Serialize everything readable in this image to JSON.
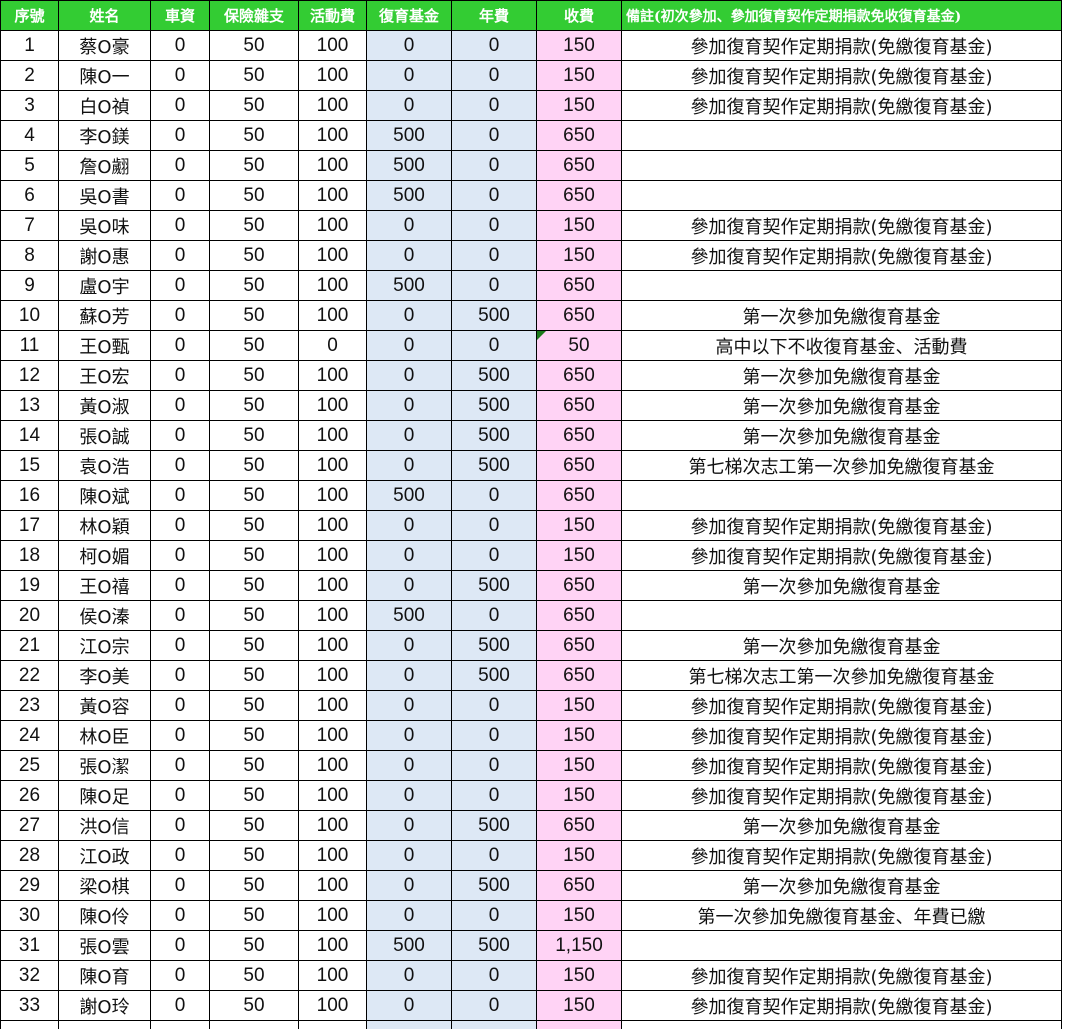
{
  "headers": [
    "序號",
    "姓名",
    "車資",
    "保險雜支",
    "活動費",
    "復育基金",
    "年費",
    "收費",
    "備註(初次參加、參加復育契作定期捐款免收復育基金)"
  ],
  "rows": [
    {
      "no": "1",
      "name": "蔡O豪",
      "fare": "0",
      "insurance": "50",
      "activity": "100",
      "fund": "0",
      "annual": "0",
      "total": "150",
      "note": "參加復育契作定期捐款(免繳復育基金)"
    },
    {
      "no": "2",
      "name": "陳O一",
      "fare": "0",
      "insurance": "50",
      "activity": "100",
      "fund": "0",
      "annual": "0",
      "total": "150",
      "note": "參加復育契作定期捐款(免繳復育基金)"
    },
    {
      "no": "3",
      "name": "白O禎",
      "fare": "0",
      "insurance": "50",
      "activity": "100",
      "fund": "0",
      "annual": "0",
      "total": "150",
      "note": "參加復育契作定期捐款(免繳復育基金)"
    },
    {
      "no": "4",
      "name": "李O鎂",
      "fare": "0",
      "insurance": "50",
      "activity": "100",
      "fund": "500",
      "annual": "0",
      "total": "650",
      "note": ""
    },
    {
      "no": "5",
      "name": "詹O翽",
      "fare": "0",
      "insurance": "50",
      "activity": "100",
      "fund": "500",
      "annual": "0",
      "total": "650",
      "note": ""
    },
    {
      "no": "6",
      "name": "吳O書",
      "fare": "0",
      "insurance": "50",
      "activity": "100",
      "fund": "500",
      "annual": "0",
      "total": "650",
      "note": ""
    },
    {
      "no": "7",
      "name": "吳O味",
      "fare": "0",
      "insurance": "50",
      "activity": "100",
      "fund": "0",
      "annual": "0",
      "total": "150",
      "note": "參加復育契作定期捐款(免繳復育基金)"
    },
    {
      "no": "8",
      "name": "謝O惠",
      "fare": "0",
      "insurance": "50",
      "activity": "100",
      "fund": "0",
      "annual": "0",
      "total": "150",
      "note": "參加復育契作定期捐款(免繳復育基金)"
    },
    {
      "no": "9",
      "name": "盧O宇",
      "fare": "0",
      "insurance": "50",
      "activity": "100",
      "fund": "500",
      "annual": "0",
      "total": "650",
      "note": ""
    },
    {
      "no": "10",
      "name": "蘇O芳",
      "fare": "0",
      "insurance": "50",
      "activity": "100",
      "fund": "0",
      "annual": "500",
      "total": "650",
      "note": "第一次參加免繳復育基金"
    },
    {
      "no": "11",
      "name": "王O甄",
      "fare": "0",
      "insurance": "50",
      "activity": "0",
      "fund": "0",
      "annual": "0",
      "total": "50",
      "note": "高中以下不收復育基金、活動費",
      "flag": "true"
    },
    {
      "no": "12",
      "name": "王O宏",
      "fare": "0",
      "insurance": "50",
      "activity": "100",
      "fund": "0",
      "annual": "500",
      "total": "650",
      "note": "第一次參加免繳復育基金"
    },
    {
      "no": "13",
      "name": "黃O淑",
      "fare": "0",
      "insurance": "50",
      "activity": "100",
      "fund": "0",
      "annual": "500",
      "total": "650",
      "note": "第一次參加免繳復育基金"
    },
    {
      "no": "14",
      "name": "張O誠",
      "fare": "0",
      "insurance": "50",
      "activity": "100",
      "fund": "0",
      "annual": "500",
      "total": "650",
      "note": "第一次參加免繳復育基金"
    },
    {
      "no": "15",
      "name": "袁O浩",
      "fare": "0",
      "insurance": "50",
      "activity": "100",
      "fund": "0",
      "annual": "500",
      "total": "650",
      "note": "第七梯次志工第一次參加免繳復育基金"
    },
    {
      "no": "16",
      "name": "陳O斌",
      "fare": "0",
      "insurance": "50",
      "activity": "100",
      "fund": "500",
      "annual": "0",
      "total": "650",
      "note": ""
    },
    {
      "no": "17",
      "name": "林O穎",
      "fare": "0",
      "insurance": "50",
      "activity": "100",
      "fund": "0",
      "annual": "0",
      "total": "150",
      "note": "參加復育契作定期捐款(免繳復育基金)"
    },
    {
      "no": "18",
      "name": "柯O媚",
      "fare": "0",
      "insurance": "50",
      "activity": "100",
      "fund": "0",
      "annual": "0",
      "total": "150",
      "note": "參加復育契作定期捐款(免繳復育基金)"
    },
    {
      "no": "19",
      "name": "王O禧",
      "fare": "0",
      "insurance": "50",
      "activity": "100",
      "fund": "0",
      "annual": "500",
      "total": "650",
      "note": "第一次參加免繳復育基金"
    },
    {
      "no": "20",
      "name": "侯O溱",
      "fare": "0",
      "insurance": "50",
      "activity": "100",
      "fund": "500",
      "annual": "0",
      "total": "650",
      "note": ""
    },
    {
      "no": "21",
      "name": "江O宗",
      "fare": "0",
      "insurance": "50",
      "activity": "100",
      "fund": "0",
      "annual": "500",
      "total": "650",
      "note": "第一次參加免繳復育基金"
    },
    {
      "no": "22",
      "name": "李O美",
      "fare": "0",
      "insurance": "50",
      "activity": "100",
      "fund": "0",
      "annual": "500",
      "total": "650",
      "note": "第七梯次志工第一次參加免繳復育基金"
    },
    {
      "no": "23",
      "name": "黃O容",
      "fare": "0",
      "insurance": "50",
      "activity": "100",
      "fund": "0",
      "annual": "0",
      "total": "150",
      "note": "參加復育契作定期捐款(免繳復育基金)"
    },
    {
      "no": "24",
      "name": "林O臣",
      "fare": "0",
      "insurance": "50",
      "activity": "100",
      "fund": "0",
      "annual": "0",
      "total": "150",
      "note": "參加復育契作定期捐款(免繳復育基金)"
    },
    {
      "no": "25",
      "name": "張O潔",
      "fare": "0",
      "insurance": "50",
      "activity": "100",
      "fund": "0",
      "annual": "0",
      "total": "150",
      "note": "參加復育契作定期捐款(免繳復育基金)"
    },
    {
      "no": "26",
      "name": "陳O足",
      "fare": "0",
      "insurance": "50",
      "activity": "100",
      "fund": "0",
      "annual": "0",
      "total": "150",
      "note": "參加復育契作定期捐款(免繳復育基金)"
    },
    {
      "no": "27",
      "name": "洪O信",
      "fare": "0",
      "insurance": "50",
      "activity": "100",
      "fund": "0",
      "annual": "500",
      "total": "650",
      "note": "第一次參加免繳復育基金"
    },
    {
      "no": "28",
      "name": "江O政",
      "fare": "0",
      "insurance": "50",
      "activity": "100",
      "fund": "0",
      "annual": "0",
      "total": "150",
      "note": "參加復育契作定期捐款(免繳復育基金)"
    },
    {
      "no": "29",
      "name": "梁O棋",
      "fare": "0",
      "insurance": "50",
      "activity": "100",
      "fund": "0",
      "annual": "500",
      "total": "650",
      "note": "第一次參加免繳復育基金"
    },
    {
      "no": "30",
      "name": "陳O伶",
      "fare": "0",
      "insurance": "50",
      "activity": "100",
      "fund": "0",
      "annual": "0",
      "total": "150",
      "note": "第一次參加免繳復育基金、年費已繳"
    },
    {
      "no": "31",
      "name": "張O雲",
      "fare": "0",
      "insurance": "50",
      "activity": "100",
      "fund": "500",
      "annual": "500",
      "total": "1,150",
      "note": ""
    },
    {
      "no": "32",
      "name": "陳O育",
      "fare": "0",
      "insurance": "50",
      "activity": "100",
      "fund": "0",
      "annual": "0",
      "total": "150",
      "note": "參加復育契作定期捐款(免繳復育基金)"
    },
    {
      "no": "33",
      "name": "謝O玲",
      "fare": "0",
      "insurance": "50",
      "activity": "100",
      "fund": "0",
      "annual": "0",
      "total": "150",
      "note": "參加復育契作定期捐款(免繳復育基金)"
    }
  ],
  "colors": {
    "header_bg": "#33cc33",
    "header_text": "#ffffff",
    "fund_bg": "#dde8f5",
    "total_bg": "#ffd3f5",
    "comment_flag": "#1a7a1a"
  }
}
